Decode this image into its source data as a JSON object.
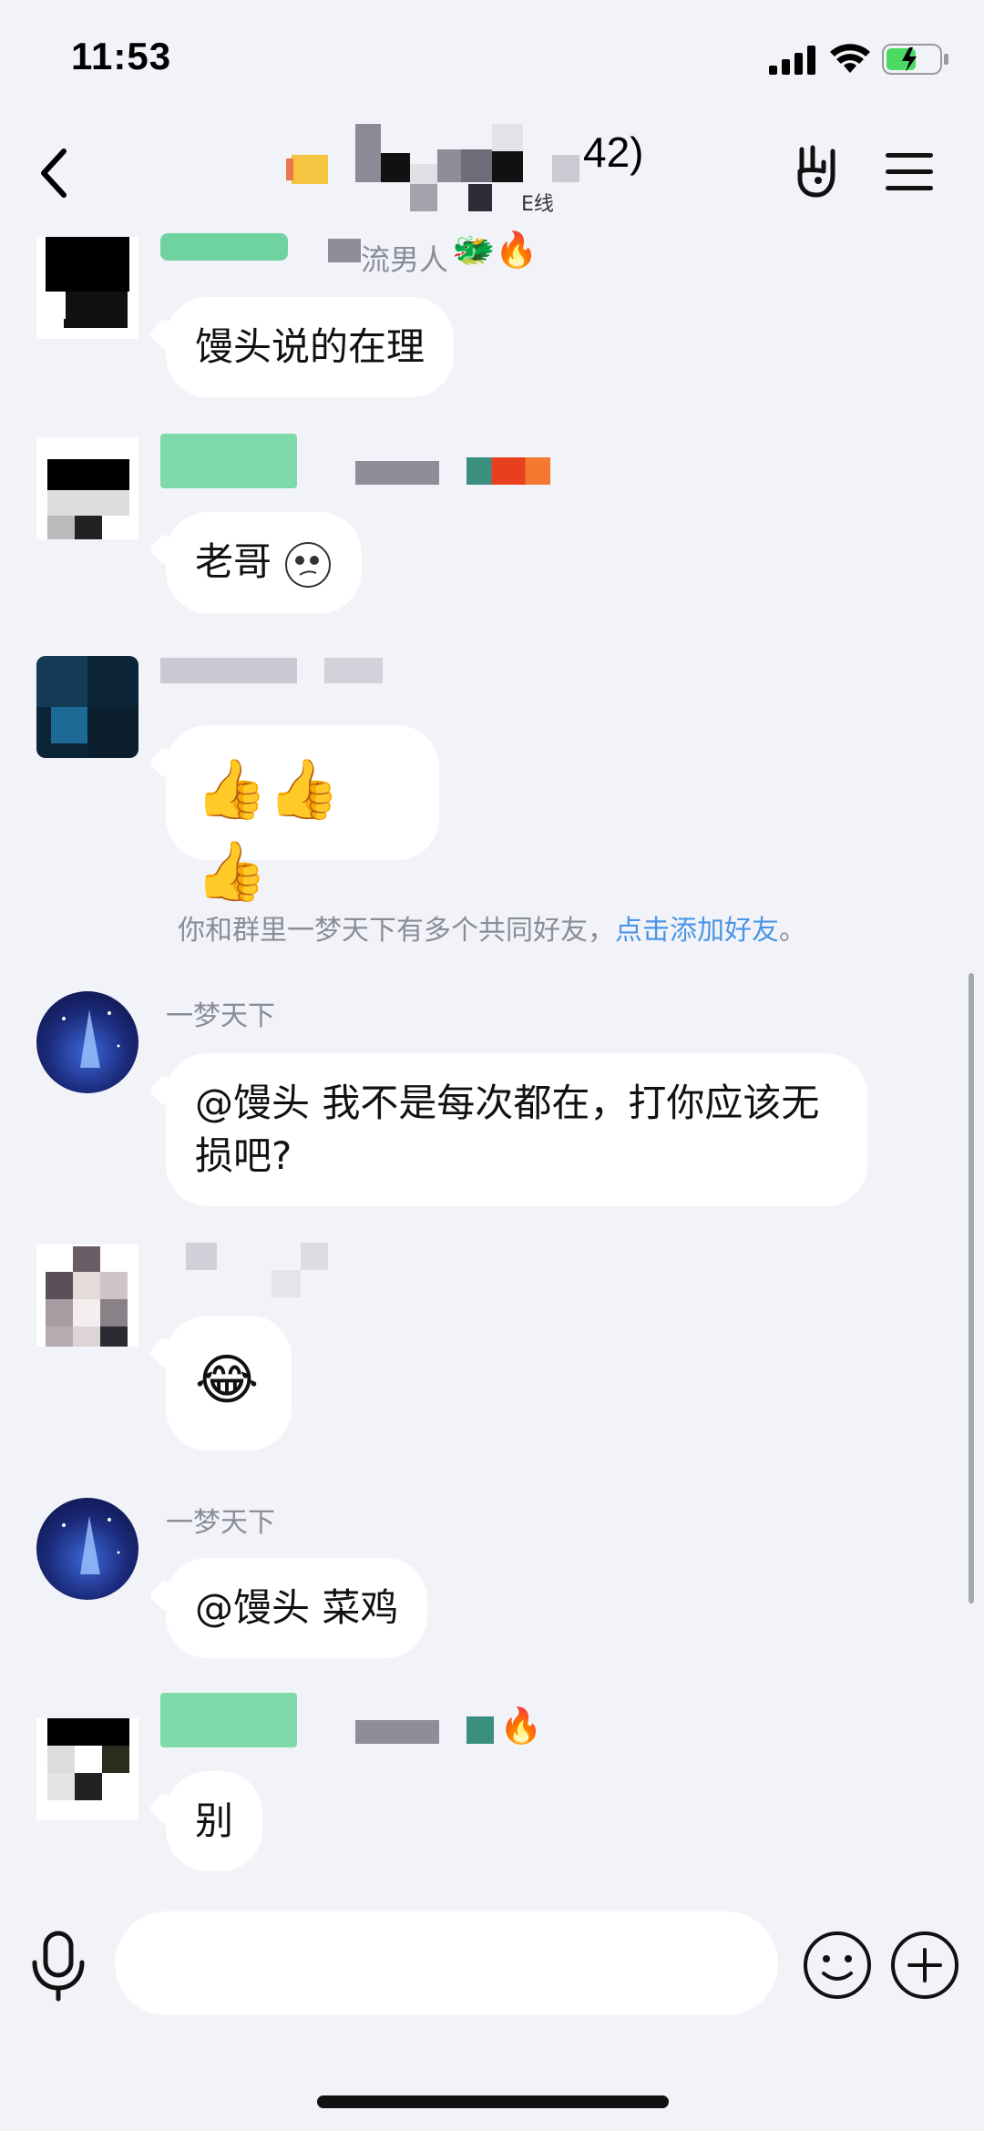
{
  "status_bar": {
    "time": "11:53"
  },
  "header": {
    "title_count": "42)",
    "title_sub": "E线"
  },
  "messages": [
    {
      "id": "m1",
      "sender_fragment": "流男人",
      "text": "馒头说的在理"
    },
    {
      "id": "m2",
      "text": "老哥"
    },
    {
      "id": "m3",
      "text": ""
    },
    {
      "id": "m4",
      "sender": "一梦天下",
      "text": "@馒头 我不是每次都在，打你应该无损吧?"
    },
    {
      "id": "m5",
      "text": ""
    },
    {
      "id": "m6",
      "sender": "一梦天下",
      "text": "@馒头 菜鸡"
    },
    {
      "id": "m7",
      "text": "别"
    }
  ],
  "system_notice": {
    "text": "你和群里一梦天下有多个共同好友，",
    "link": "点击添加好友",
    "suffix": "。"
  },
  "icons": {
    "back": "chevron-left-icon",
    "gesture": "rock-hand-icon",
    "menu": "hamburger-menu-icon",
    "voice": "microphone-icon",
    "emoji": "smiley-icon",
    "more": "plus-circle-icon"
  },
  "colors": {
    "background": "#f2f3f8",
    "bubble": "#ffffff",
    "link": "#4b95e6",
    "name_gray": "#8a8d99",
    "title_tag_green": "#6fd3a0"
  }
}
